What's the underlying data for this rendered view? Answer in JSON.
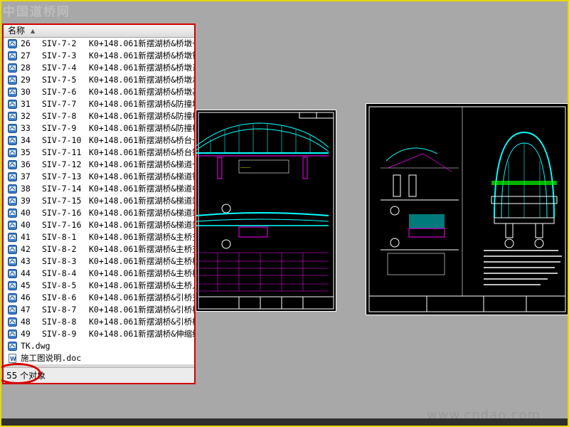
{
  "watermark_top": "中国道桥网",
  "watermark_bottom": "www.cndao.com",
  "explorer": {
    "column_header": "名称",
    "sort_icon": "sort-up-arrow",
    "rows": [
      {
        "num": "26",
        "code": "SIV-7-2",
        "desc": "K0+148.061新摆湖桥&桥墩一"
      },
      {
        "num": "27",
        "code": "SIV-7-3",
        "desc": "K0+148.061新摆湖桥&桥墩钢"
      },
      {
        "num": "28",
        "code": "SIV-7-4",
        "desc": "K0+148.061新摆湖桥&桥墩系"
      },
      {
        "num": "29",
        "code": "SIV-7-5",
        "desc": "K0+148.061新摆湖桥&桥墩承"
      },
      {
        "num": "30",
        "code": "SIV-7-6",
        "desc": "K0+148.061新摆湖桥&桥墩基"
      },
      {
        "num": "31",
        "code": "SIV-7-7",
        "desc": "K0+148.061新摆湖桥&防撞墩"
      },
      {
        "num": "32",
        "code": "SIV-7-8",
        "desc": "K0+148.061新摆湖桥&防撞桩"
      },
      {
        "num": "33",
        "code": "SIV-7-9",
        "desc": "K0+148.061新摆湖桥&防撞桩"
      },
      {
        "num": "34",
        "code": "SIV-7-10",
        "desc": "K0+148.061新摆湖桥&桥台一"
      },
      {
        "num": "35",
        "code": "SIV-7-11",
        "desc": "K0+148.061新摆湖桥&桥台钢"
      },
      {
        "num": "36",
        "code": "SIV-7-12",
        "desc": "K0+148.061新摆湖桥&梯道一"
      },
      {
        "num": "37",
        "code": "SIV-7-13",
        "desc": "K0+148.061新摆湖桥&梯道钢"
      },
      {
        "num": "38",
        "code": "SIV-7-14",
        "desc": "K0+148.061新摆湖桥&梯道中"
      },
      {
        "num": "39",
        "code": "SIV-7-15",
        "desc": "K0+148.061新摆湖桥&梯道端"
      },
      {
        "num": "40",
        "code": "SIV-7-16",
        "desc": "K0+148.061新摆湖桥&梯道端"
      },
      {
        "num": "40",
        "code": "SIV-7-16",
        "desc": "K0+148.061新摆湖桥&梯道端"
      },
      {
        "num": "41",
        "code": "SIV-8-1",
        "desc": "K0+148.061新摆湖桥&主桥支"
      },
      {
        "num": "42",
        "code": "SIV-8-2",
        "desc": "K0+148.061新摆湖桥&主桥支"
      },
      {
        "num": "43",
        "code": "SIV-8-3",
        "desc": "K0+148.061新摆湖桥&主桥桥"
      },
      {
        "num": "44",
        "code": "SIV-8-4",
        "desc": "K0+148.061新摆湖桥&主桥桥"
      },
      {
        "num": "45",
        "code": "SIV-8-5",
        "desc": "K0+148.061新摆湖桥&主桥人"
      },
      {
        "num": "46",
        "code": "SIV-8-6",
        "desc": "K0+148.061新摆湖桥&引桥支"
      },
      {
        "num": "47",
        "code": "SIV-8-7",
        "desc": "K0+148.061新摆湖桥&引桥桥"
      },
      {
        "num": "48",
        "code": "SIV-8-8",
        "desc": "K0+148.061新摆湖桥&引桥桥"
      },
      {
        "num": "49",
        "code": "SIV-8-9",
        "desc": "K0+148.061新摆湖桥&伸缩缝"
      }
    ],
    "files": [
      {
        "name": "TK.dwg",
        "icon": "dwg-file-icon"
      },
      {
        "name": "施工图说明.doc",
        "icon": "word-doc-icon"
      }
    ],
    "status_text": "55 个对象"
  },
  "colors": {
    "frame": "#e8d800",
    "highlight_red": "#d40000",
    "cad_background": "#000000",
    "cad_cyan": "#00ffff",
    "cad_magenta": "#ff00ff",
    "cad_white": "#ffffff"
  }
}
